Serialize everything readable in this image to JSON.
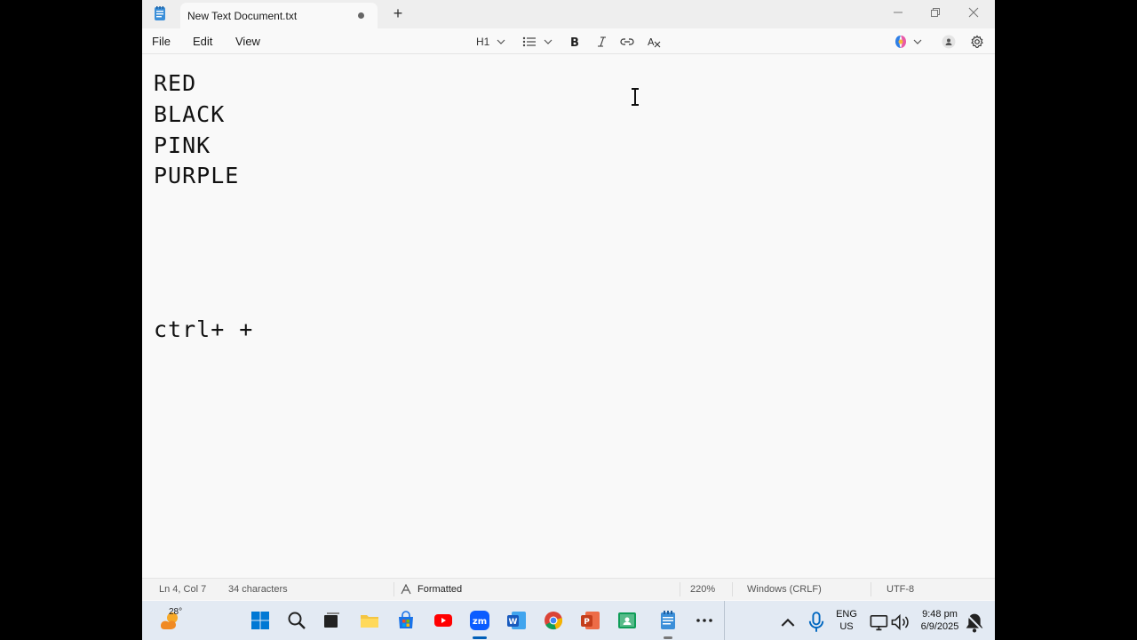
{
  "window": {
    "tab_title": "New Text Document.txt"
  },
  "menu": {
    "file": "File",
    "edit": "Edit",
    "view": "View"
  },
  "toolbar": {
    "heading": "H1",
    "icons": [
      "list-icon",
      "bold-icon",
      "italic-icon",
      "link-icon",
      "clear-format-icon",
      "copilot-icon",
      "account-icon",
      "gear-icon"
    ]
  },
  "editor": {
    "lines": [
      "RED",
      "BLACK",
      "PINK",
      "PURPLE",
      "ctrl+ +"
    ]
  },
  "status": {
    "position": "Ln 4, Col 7",
    "characters": "34 characters",
    "mode": "Formatted",
    "zoom": "220%",
    "line_ending": "Windows (CRLF)",
    "encoding": "UTF-8"
  },
  "taskbar": {
    "temperature": "28°",
    "apps": [
      "start-icon",
      "search-icon",
      "task-view-icon",
      "file-explorer-icon",
      "store-icon",
      "youtube-icon",
      "zoom-icon",
      "word-icon",
      "chrome-icon",
      "powerpoint-icon",
      "classroom-icon",
      "notepad-icon",
      "more-icon"
    ],
    "language": "ENG",
    "region": "US",
    "time": "9:48 pm",
    "date": "6/9/2025"
  },
  "colors": {
    "accent": "#005fb8",
    "background": "#f9f9f9"
  }
}
